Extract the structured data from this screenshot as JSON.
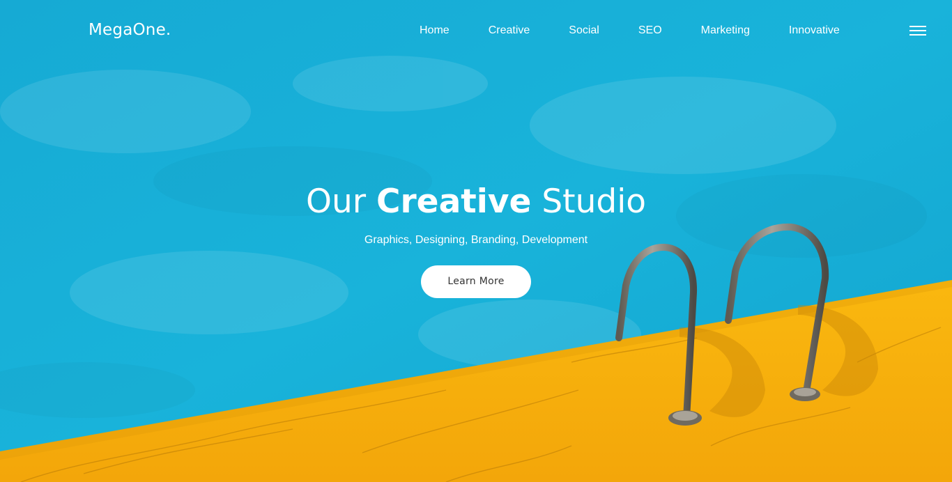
{
  "brand": {
    "logo": "MegaOne."
  },
  "nav": {
    "items": [
      {
        "label": "Home"
      },
      {
        "label": "Creative"
      },
      {
        "label": "Social"
      },
      {
        "label": "SEO"
      },
      {
        "label": "Marketing"
      },
      {
        "label": "Innovative"
      }
    ],
    "menu_icon": "hamburger-icon"
  },
  "hero": {
    "title_prefix": "Our",
    "title_bold": "Creative",
    "title_suffix": "Studio",
    "subtitle": "Graphics, Designing, Branding, Development",
    "cta_label": "Learn More",
    "background": "pool-ladder-photo"
  },
  "colors": {
    "pool_blue": "#16afd6",
    "deck_yellow": "#f7b00d",
    "text_white": "#ffffff"
  }
}
